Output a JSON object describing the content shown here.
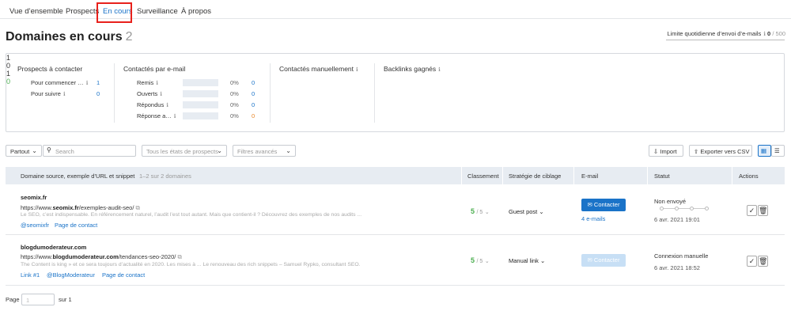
{
  "tabs": [
    {
      "label": "Vue d’ensemble",
      "active": false
    },
    {
      "label": "Prospects",
      "active": false
    },
    {
      "label": "En cours",
      "active": true
    },
    {
      "label": "Surveillance",
      "active": false
    },
    {
      "label": "À propos",
      "active": false
    }
  ],
  "page": {
    "title": "Domaines en cours",
    "count": "2"
  },
  "daily_limit": {
    "label": "Limite quotidienne d’envoi d’e-mails",
    "value": "0",
    "max": "/ 500"
  },
  "summary": {
    "prospects": {
      "title": "Prospects à contacter",
      "total": "1",
      "rows": [
        {
          "label": "Pour commencer …",
          "value": "1"
        },
        {
          "label": "Pour suivre",
          "value": "0"
        }
      ]
    },
    "email": {
      "title": "Contactés par e-mail",
      "total": "0",
      "rows": [
        {
          "label": "Remis",
          "pct": "0%",
          "value": "0"
        },
        {
          "label": "Ouverts",
          "pct": "0%",
          "value": "0"
        },
        {
          "label": "Répondus",
          "pct": "0%",
          "value": "0"
        },
        {
          "label": "Réponse a…",
          "pct": "0%",
          "value": "0"
        }
      ]
    },
    "manual": {
      "title": "Contactés manuellement",
      "total": "1"
    },
    "backlinks": {
      "title": "Backlinks gagnés",
      "total": "0"
    }
  },
  "filters": {
    "partout": "Partout",
    "search_placeholder": "Search",
    "states": "Tous les états de prospects",
    "advanced": "Filtres avancés",
    "import": "Import",
    "export": "Exporter vers CSV"
  },
  "table": {
    "headers": {
      "source": "Domaine source, exemple d’URL et snippet",
      "source_count": "1–2 sur 2 domaines",
      "rank": "Classement",
      "strategy": "Stratégie de ciblage",
      "email": "E-mail",
      "status": "Statut",
      "actions": "Actions"
    },
    "rows": [
      {
        "domain": "seomix.fr",
        "url_prefix": "https://www.",
        "url_domain": "seomix.fr",
        "url_path": "/exemples-audit-seo/",
        "snippet": "Le SEO, c’est indispensable. En référencement naturel, l’audit l’est tout autant. Mais que contient-il ? Découvrez des exemples de nos audits ...",
        "links": [
          "@seomixfr",
          "Page de contact"
        ],
        "rank": "5",
        "rank_of": "/ 5",
        "strategy": "Guest post",
        "contact_label": "Contacter",
        "emails": "4 e-mails",
        "status": "Non envoyé",
        "date": "6 avr. 2021 19:01"
      },
      {
        "domain": "blogdumoderateur.com",
        "url_prefix": "https://www.",
        "url_domain": "blogdumoderateur.com",
        "url_path": "/tendances-seo-2020/",
        "snippet": "The Content is king » et ce sera toujours d’actualité en 2020. Les mises à ... Le renouveau des rich snippets – Samuel Rypko, consultant SEO.",
        "links": [
          "Link #1",
          "@BlogModerateur",
          "Page de contact"
        ],
        "rank": "5",
        "rank_of": "/ 5",
        "strategy": "Manual link",
        "contact_label": "Contacter",
        "status": "Connexion manuelle",
        "date": "6 avr. 2021 18:52"
      }
    ]
  },
  "pager": {
    "label": "Page",
    "placeholder": "1",
    "of": "sur 1"
  },
  "colors": {
    "accent": "#1a73c8",
    "highlight": "#e8211c",
    "success": "#4caf50"
  },
  "icons": [
    "search-icon",
    "info-icon",
    "external-link-icon",
    "email-icon",
    "check-icon",
    "trash-icon",
    "import-icon",
    "export-icon",
    "grid-view-icon",
    "list-view-icon",
    "chevron-down-icon"
  ]
}
